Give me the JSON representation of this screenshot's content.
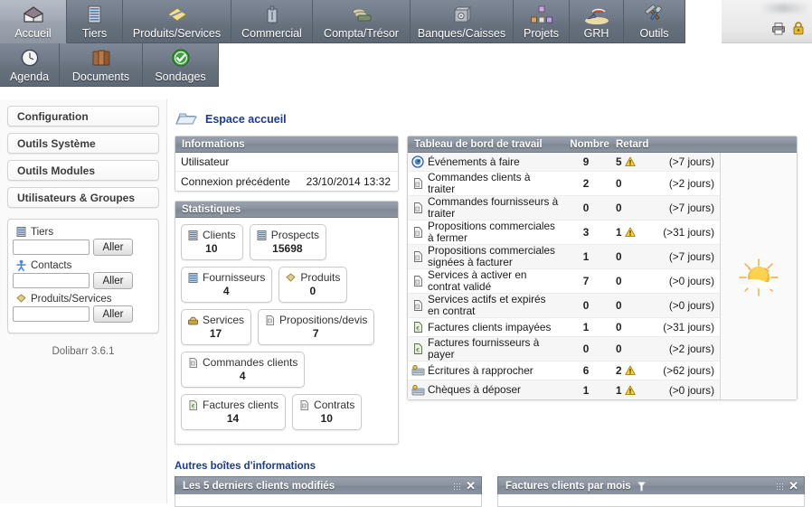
{
  "app": {
    "name": "Dolibarr",
    "version_label": "Dolibarr 3.6.1"
  },
  "topmenu": {
    "row1": [
      {
        "label": "Accueil",
        "icon": "home-icon",
        "selected": true
      },
      {
        "label": "Tiers",
        "icon": "building-icon",
        "selected": false
      },
      {
        "label": "Produits/Services",
        "icon": "package-icon",
        "selected": false
      },
      {
        "label": "Commercial",
        "icon": "briefcase-icon",
        "selected": false
      },
      {
        "label": "Compta/Trésor",
        "icon": "money-icon",
        "selected": false
      },
      {
        "label": "Banques/Caisses",
        "icon": "safe-icon",
        "selected": false
      },
      {
        "label": "Projets",
        "icon": "sitemap-icon",
        "selected": false
      },
      {
        "label": "GRH",
        "icon": "beach-icon",
        "selected": false
      },
      {
        "label": "Outils",
        "icon": "tools-icon",
        "selected": false
      }
    ],
    "row2": [
      {
        "label": "Agenda",
        "icon": "clock-icon",
        "selected": false
      },
      {
        "label": "Documents",
        "icon": "documents-icon",
        "selected": false
      },
      {
        "label": "Sondages",
        "icon": "check-icon",
        "selected": false
      }
    ],
    "right_icons": [
      {
        "name": "printer-icon"
      },
      {
        "name": "lock-icon"
      }
    ]
  },
  "sidebar": {
    "menus": [
      {
        "label": "Configuration"
      },
      {
        "label": "Outils Système"
      },
      {
        "label": "Outils Modules"
      },
      {
        "label": "Utilisateurs & Groupes"
      }
    ],
    "search": {
      "go_label": "Aller",
      "rows": [
        {
          "label": "Tiers",
          "icon": "building-icon",
          "value": "",
          "placeholder": ""
        },
        {
          "label": "Contacts",
          "icon": "person-icon",
          "value": "",
          "placeholder": ""
        },
        {
          "label": "Produits/Services",
          "icon": "package-icon",
          "value": "",
          "placeholder": ""
        }
      ]
    }
  },
  "page": {
    "title": "Espace accueil",
    "title_icon": "folder-icon"
  },
  "informations": {
    "header": "Informations",
    "rows": [
      {
        "label": "Utilisateur",
        "value": "",
        "redacted": true
      },
      {
        "label": "Connexion précédente",
        "value": "23/10/2014 13:32",
        "redacted": false
      }
    ]
  },
  "statistiques": {
    "header": "Statistiques",
    "lines": [
      [
        {
          "label": "Clients",
          "value": "10",
          "icon": "building-icon"
        },
        {
          "label": "Prospects",
          "value": "15698",
          "icon": "building-icon"
        }
      ],
      [
        {
          "label": "Fournisseurs",
          "value": "4",
          "icon": "building-icon"
        },
        {
          "label": "Produits",
          "value": "0",
          "icon": "package-icon"
        }
      ],
      [
        {
          "label": "Services",
          "value": "17",
          "icon": "service-icon"
        },
        {
          "label": "Propositions/devis",
          "value": "7",
          "icon": "proposal-icon"
        }
      ],
      [
        {
          "label": "Commandes clients",
          "value": "4",
          "icon": "order-icon"
        }
      ],
      [
        {
          "label": "Factures clients",
          "value": "14",
          "icon": "invoice-icon"
        },
        {
          "label": "Contrats",
          "value": "10",
          "icon": "contract-icon"
        }
      ]
    ]
  },
  "dashboard": {
    "header": {
      "title": "Tableau de bord de travail",
      "count": "Nombre",
      "late": "Retard"
    },
    "weather_icon": "sun-cloud-icon",
    "rows": [
      {
        "icon": "event-icon",
        "label": "Événements à faire",
        "count": "9",
        "late": "1",
        "late_value": "5",
        "warn": true,
        "delay": "(>7 jours)"
      },
      {
        "icon": "order-icon",
        "label": "Commandes clients à traiter",
        "count": "2",
        "late_value": "0",
        "warn": false,
        "delay": "(>2 jours)"
      },
      {
        "icon": "order-icon",
        "label": "Commandes fournisseurs à traiter",
        "count": "0",
        "late_value": "0",
        "warn": false,
        "delay": "(>7 jours)"
      },
      {
        "icon": "proposal-icon",
        "label": "Propositions commerciales à fermer",
        "count": "3",
        "late_value": "1",
        "warn": true,
        "delay": "(>31 jours)"
      },
      {
        "icon": "proposal-icon",
        "label": "Propositions commerciales signées à facturer",
        "count": "1",
        "late_value": "0",
        "warn": false,
        "delay": "(>7 jours)"
      },
      {
        "icon": "contract-icon",
        "label": "Services à activer en contrat validé",
        "count": "7",
        "late_value": "0",
        "warn": false,
        "delay": "(>0 jours)"
      },
      {
        "icon": "contract-icon",
        "label": "Services actifs et expirés en contrat",
        "count": "0",
        "late_value": "0",
        "warn": false,
        "delay": "(>0 jours)"
      },
      {
        "icon": "invoice-icon",
        "label": "Factures clients impayées",
        "count": "1",
        "late_value": "0",
        "warn": false,
        "delay": "(>31 jours)"
      },
      {
        "icon": "invoice-icon",
        "label": "Factures fournisseurs à payer",
        "count": "0",
        "late_value": "0",
        "warn": false,
        "delay": "(>2 jours)"
      },
      {
        "icon": "bank-icon",
        "label": "Écritures à rapprocher",
        "count": "6",
        "late_value": "2",
        "warn": true,
        "delay": "(>62 jours)"
      },
      {
        "icon": "bank-icon",
        "label": "Chèques à déposer",
        "count": "1",
        "late_value": "1",
        "warn": true,
        "delay": "(>0 jours)"
      }
    ]
  },
  "other_boxes": {
    "title": "Autres boîtes d'informations",
    "boxes": [
      {
        "title": "Les 5 derniers clients modifiés",
        "has_tooltip": false,
        "close_label": "✕"
      },
      {
        "title": "Factures clients par mois",
        "has_tooltip": true,
        "tooltip_icon": "help-icon",
        "close_label": "✕"
      }
    ]
  },
  "colors": {
    "menu_bg": "#6e7886",
    "menu_selected_bg": "#a4abb6",
    "panel_header": "#8a929f",
    "title_blue": "#1b3c8c",
    "warn_yellow": "#f0c419"
  }
}
